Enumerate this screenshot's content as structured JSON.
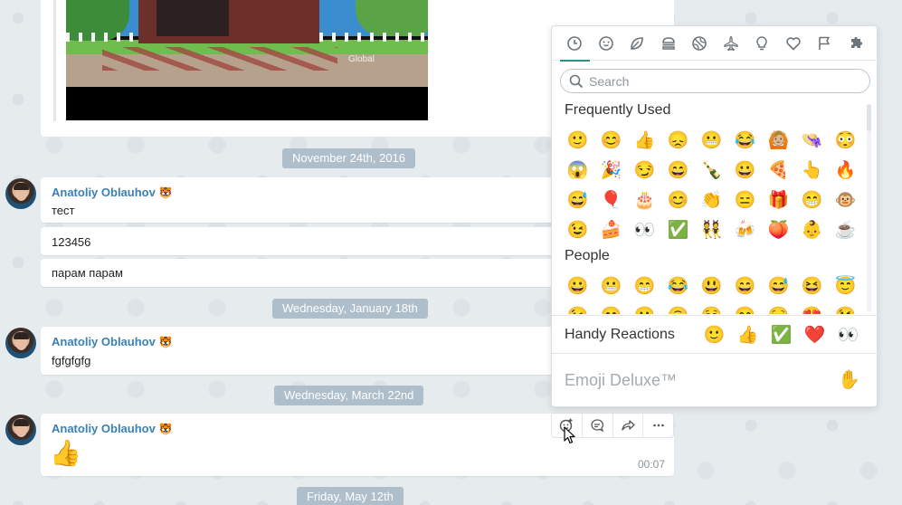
{
  "chat": {
    "media_watermark": "Global",
    "dates": [
      "November 24th, 2016",
      "Wednesday, January 18th",
      "Wednesday, March 22nd",
      "Friday, May 12th"
    ],
    "sender": "Anatoliy Oblauhov",
    "sender_badge": "🐯",
    "group1_messages": [
      "тест",
      "123456",
      "парам парам"
    ],
    "group2_messages": [
      "fgfgfgfg"
    ],
    "group3_emoji": "👍",
    "group3_time": "00:07"
  },
  "emoji_panel": {
    "categories": [
      {
        "name": "recent",
        "icon": "clock-icon"
      },
      {
        "name": "people",
        "icon": "smiley-icon"
      },
      {
        "name": "nature",
        "icon": "leaf-icon"
      },
      {
        "name": "food",
        "icon": "burger-icon"
      },
      {
        "name": "activity",
        "icon": "ball-icon"
      },
      {
        "name": "travel",
        "icon": "plane-icon"
      },
      {
        "name": "objects",
        "icon": "lightbulb-icon"
      },
      {
        "name": "symbols",
        "icon": "heart-icon"
      },
      {
        "name": "flags",
        "icon": "flag-icon"
      },
      {
        "name": "custom",
        "icon": "puzzle-icon"
      }
    ],
    "search_placeholder": "Search",
    "frequently_used_title": "Frequently Used",
    "frequently_used": [
      "🙂",
      "😊",
      "👍",
      "😞",
      "😬",
      "😂",
      "🙆🏼",
      "👒",
      "😳",
      "😱",
      "🎉",
      "😏",
      "😄",
      "🍾",
      "😀",
      "🍕",
      "👆",
      "🔥",
      "😅",
      "🎈",
      "🎂",
      "😊",
      "👏",
      "😑",
      "🎁",
      "😁",
      "🐵",
      "😉",
      "🍰",
      "👀",
      "✅",
      "👯",
      "🍻",
      "🍑",
      "👶",
      "☕"
    ],
    "people_title": "People",
    "people": [
      "😀",
      "😬",
      "😁",
      "😂",
      "😃",
      "😄",
      "😅",
      "😆",
      "😇",
      "😉",
      "😊",
      "🙂",
      "🙃",
      "☺️",
      "😋",
      "😌",
      "😍",
      "😘"
    ],
    "handy_reactions_title": "Handy Reactions",
    "handy_reactions": [
      "🙂",
      "👍",
      "✅",
      "❤️",
      "👀"
    ],
    "deluxe_title": "Emoji Deluxe™",
    "deluxe_icon": "✋"
  },
  "message_actions": [
    {
      "name": "react",
      "icon": "add-reaction-icon"
    },
    {
      "name": "reply",
      "icon": "reply-icon"
    },
    {
      "name": "forward",
      "icon": "forward-icon"
    },
    {
      "name": "more",
      "icon": "more-icon"
    }
  ]
}
